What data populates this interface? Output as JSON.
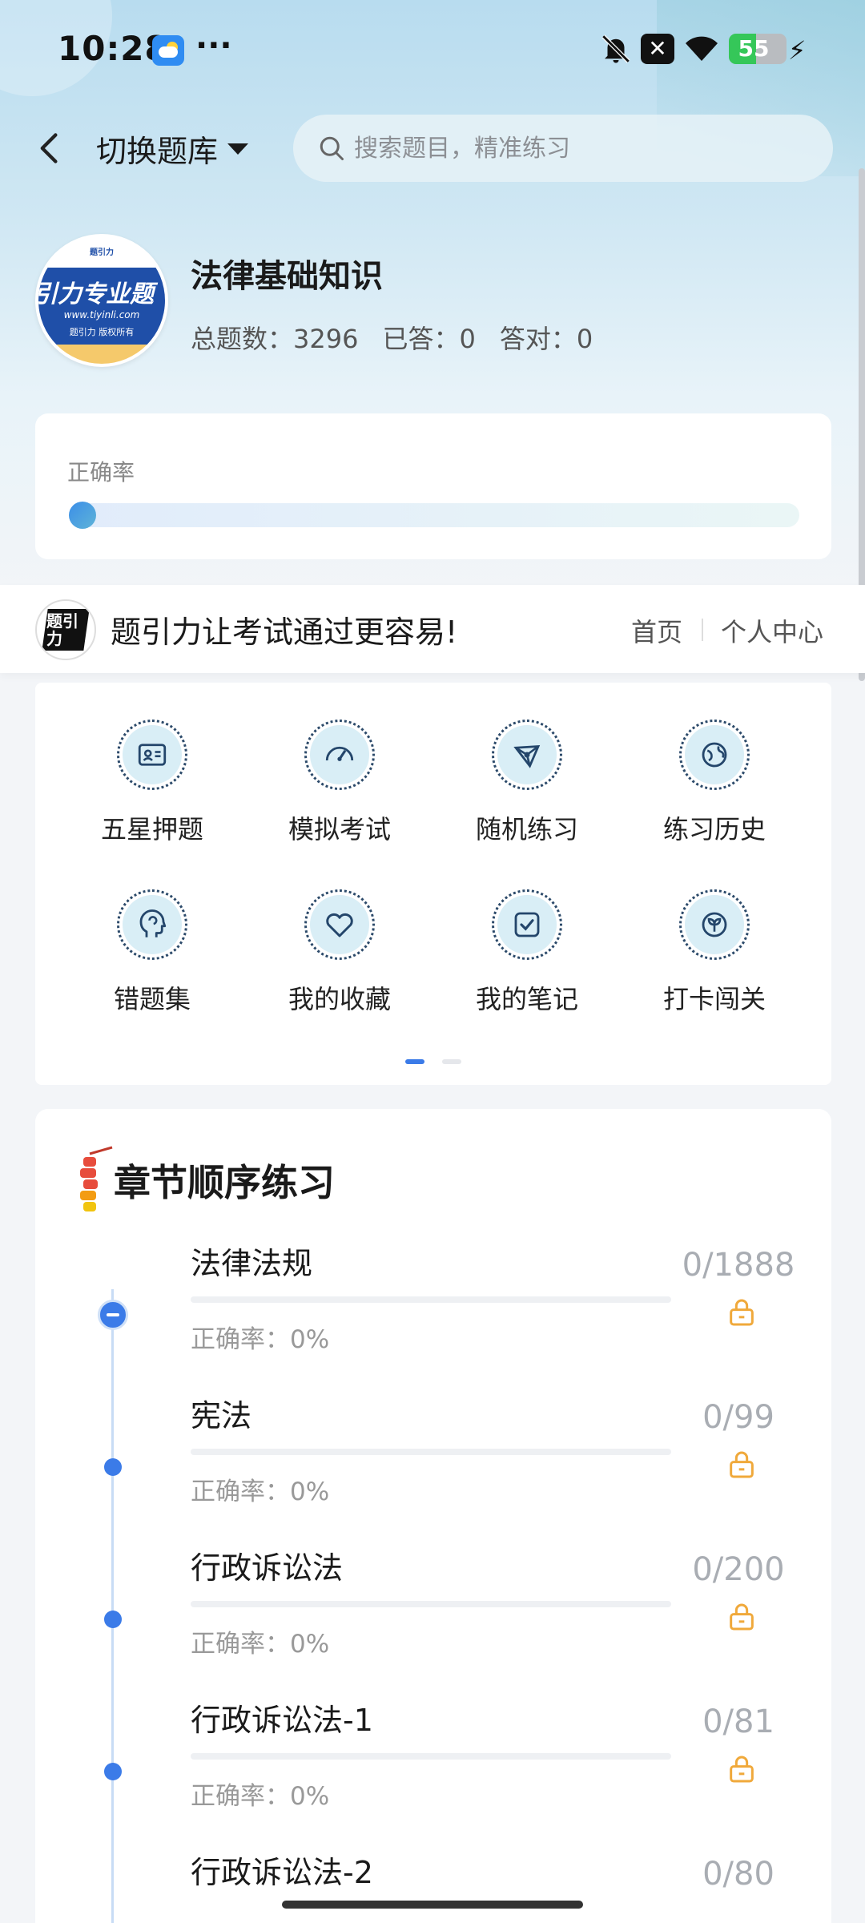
{
  "status_bar": {
    "time": "10:28",
    "more": "···",
    "battery": "55",
    "battery_level": 0.55
  },
  "header": {
    "switch_bank_label": "切换题库",
    "search_placeholder": "搜索题目，精准练习"
  },
  "course": {
    "logo_text": "引力专业题",
    "logo_url": "www.tiyinli.com",
    "logo_rights": "题引力 版权所有",
    "logo_top": "题引力",
    "title": "法律基础知识",
    "stats": [
      {
        "label": "总题数：",
        "value": "3296"
      },
      {
        "label": "已答：",
        "value": "0"
      },
      {
        "label": "答对：",
        "value": "0"
      }
    ]
  },
  "accuracy": {
    "label": "正确率",
    "value": 0
  },
  "banner": {
    "logo_text": "题引力",
    "text": "题引力让考试通过更容易!",
    "home": "首页",
    "center": "个人中心"
  },
  "functions": [
    {
      "label": "五星押题",
      "icon": "id-card-icon"
    },
    {
      "label": "模拟考试",
      "icon": "gauge-icon"
    },
    {
      "label": "随机练习",
      "icon": "network-icon"
    },
    {
      "label": "练习历史",
      "icon": "globe-icon"
    },
    {
      "label": "错题集",
      "icon": "head-icon"
    },
    {
      "label": "我的收藏",
      "icon": "heart-icon"
    },
    {
      "label": "我的笔记",
      "icon": "note-check-icon"
    },
    {
      "label": "打卡闯关",
      "icon": "leaf-icon"
    }
  ],
  "pager": {
    "current": 1,
    "total": 2
  },
  "chapters": {
    "title": "章节顺序练习",
    "items": [
      {
        "name": "法律法规",
        "accuracy": "正确率：0%",
        "count": "0/1888",
        "progress": 0
      },
      {
        "name": "宪法",
        "accuracy": "正确率：0%",
        "count": "0/99",
        "progress": 0
      },
      {
        "name": "行政诉讼法",
        "accuracy": "正确率：0%",
        "count": "0/200",
        "progress": 0
      },
      {
        "name": "行政诉讼法-1",
        "accuracy": "正确率：0%",
        "count": "0/81",
        "progress": 0
      },
      {
        "name": "行政诉讼法-2",
        "accuracy": "",
        "count": "0/80",
        "progress": 0
      }
    ]
  },
  "colors": {
    "accent": "#3b7be8",
    "lock": "#f0a93b"
  }
}
